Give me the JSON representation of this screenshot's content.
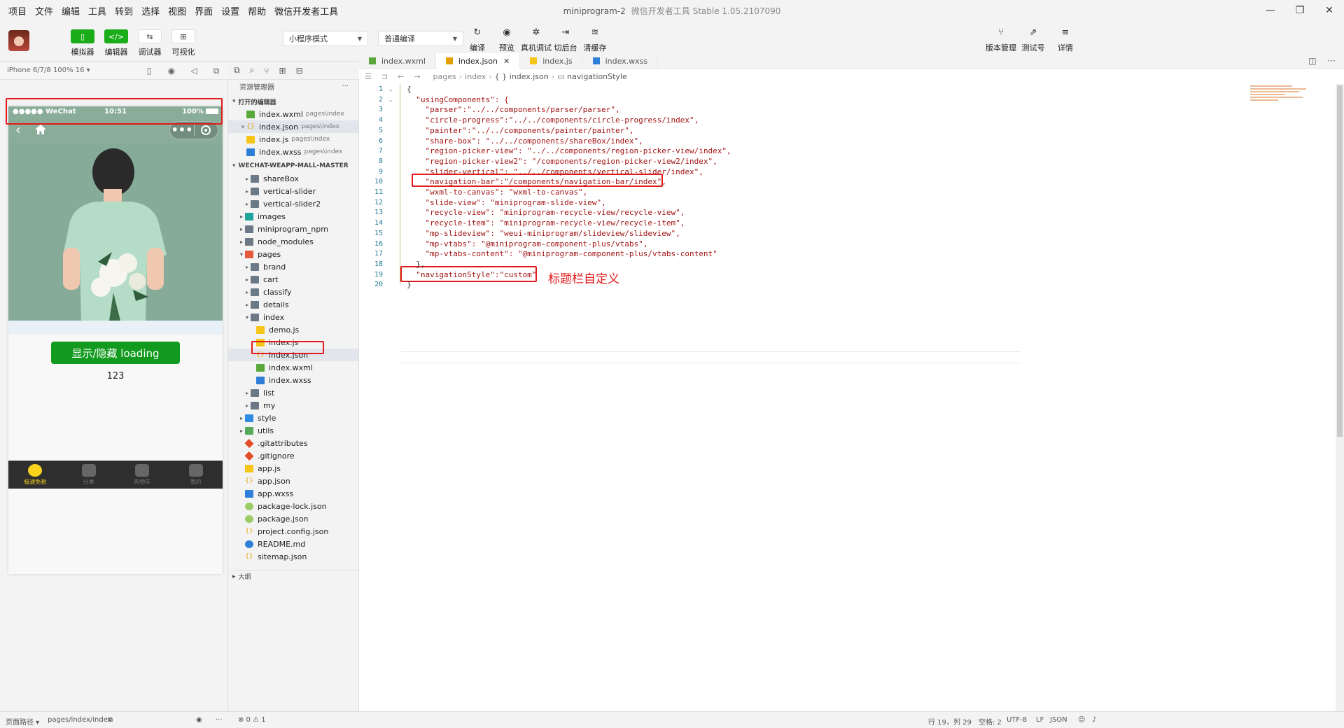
{
  "window": {
    "title": "miniprogram-2",
    "subtitle": "微信开发者工具 Stable 1.05.2107090",
    "controls": [
      "—",
      "❐",
      "✕"
    ]
  },
  "menu": [
    "项目",
    "文件",
    "编辑",
    "工具",
    "转到",
    "选择",
    "视图",
    "界面",
    "设置",
    "帮助",
    "微信开发者工具"
  ],
  "toolbar": {
    "left_buttons": [
      {
        "label": "模拟器",
        "icon": "phone-icon",
        "glyph": "▯",
        "active": true
      },
      {
        "label": "编辑器",
        "icon": "code-icon",
        "glyph": "</>",
        "active": true
      },
      {
        "label": "调试器",
        "icon": "debug-icon",
        "glyph": "⇆",
        "active": false
      },
      {
        "label": "可视化",
        "icon": "layout-icon",
        "glyph": "⊞",
        "active": false
      }
    ],
    "mode_select": "小程序模式",
    "compile_select": "普通编译",
    "middle_buttons": [
      {
        "label": "编译",
        "icon": "refresh-icon",
        "glyph": "↻"
      },
      {
        "label": "预览",
        "icon": "eye-icon",
        "glyph": "◉"
      },
      {
        "label": "真机调试",
        "icon": "bug-icon",
        "glyph": "✲"
      },
      {
        "label": "切后台",
        "icon": "switch-icon",
        "glyph": "⇥"
      },
      {
        "label": "清缓存",
        "icon": "layers-icon",
        "glyph": "≋"
      }
    ],
    "right_buttons": [
      {
        "label": "版本管理",
        "icon": "branch-icon",
        "glyph": "⑂"
      },
      {
        "label": "测试号",
        "icon": "external-icon",
        "glyph": "⇗"
      },
      {
        "label": "详情",
        "icon": "menu-icon",
        "glyph": "≡"
      }
    ]
  },
  "simulator": {
    "device": "iPhone 6/7/8 100% 16 ▾",
    "icons": [
      "▯",
      "◉",
      "◁",
      "⧉"
    ],
    "status_signal": "●●●●● WeChat",
    "status_time": "10:51",
    "status_battery": "100%",
    "button_label": "显示/隐藏 loading",
    "count": "123",
    "tabbar": [
      {
        "label": "极速免税",
        "active": true
      },
      {
        "label": "分类",
        "active": false
      },
      {
        "label": "购物车",
        "active": false
      },
      {
        "label": "我的",
        "active": false
      }
    ]
  },
  "explorer": {
    "icons": [
      "⧉",
      "⌕",
      "⑂",
      "⊞",
      "⊟"
    ],
    "title": "资源管理器",
    "more": "···",
    "open_editors_label": "打开的编辑器",
    "open_editors": [
      {
        "name": "index.wxml",
        "path": "pages\\index",
        "type": "wxml",
        "selected": false,
        "close": ""
      },
      {
        "name": "index.json",
        "path": "pages\\index",
        "type": "json",
        "selected": true,
        "close": "✕"
      },
      {
        "name": "index.js",
        "path": "pages\\index",
        "type": "js",
        "selected": false,
        "close": ""
      },
      {
        "name": "index.wxss",
        "path": "pages\\index",
        "type": "wxss",
        "selected": false,
        "close": ""
      }
    ],
    "project_label": "WECHAT-WEAPP-MALL-MASTER",
    "tree": [
      {
        "name": "shareBox",
        "type": "folder",
        "depth": 2,
        "caret": "▸"
      },
      {
        "name": "vertical-slider",
        "type": "folder",
        "depth": 2,
        "caret": "▸"
      },
      {
        "name": "vertical-slider2",
        "type": "folder",
        "depth": 2,
        "caret": "▸"
      },
      {
        "name": "images",
        "type": "img",
        "depth": 1,
        "caret": "▸"
      },
      {
        "name": "miniprogram_npm",
        "type": "folder",
        "depth": 1,
        "caret": "▸"
      },
      {
        "name": "node_modules",
        "type": "folder",
        "depth": 1,
        "caret": "▸"
      },
      {
        "name": "pages",
        "type": "red",
        "depth": 1,
        "caret": "▾"
      },
      {
        "name": "brand",
        "type": "folder",
        "depth": 2,
        "caret": "▸"
      },
      {
        "name": "cart",
        "type": "folder",
        "depth": 2,
        "caret": "▸"
      },
      {
        "name": "classify",
        "type": "folder",
        "depth": 2,
        "caret": "▸"
      },
      {
        "name": "details",
        "type": "folder",
        "depth": 2,
        "caret": "▸"
      },
      {
        "name": "index",
        "type": "folder",
        "depth": 2,
        "caret": "▾"
      },
      {
        "name": "demo.js",
        "type": "js",
        "depth": 3,
        "caret": ""
      },
      {
        "name": "index.js",
        "type": "js",
        "depth": 3,
        "caret": ""
      },
      {
        "name": "index.json",
        "type": "json",
        "depth": 3,
        "caret": "",
        "selected": true
      },
      {
        "name": "index.wxml",
        "type": "wxml",
        "depth": 3,
        "caret": ""
      },
      {
        "name": "index.wxss",
        "type": "wxss",
        "depth": 3,
        "caret": ""
      },
      {
        "name": "list",
        "type": "folder",
        "depth": 2,
        "caret": "▸"
      },
      {
        "name": "my",
        "type": "folder",
        "depth": 2,
        "caret": "▸"
      },
      {
        "name": "style",
        "type": "sty",
        "depth": 1,
        "caret": "▸"
      },
      {
        "name": "utils",
        "type": "utl",
        "depth": 1,
        "caret": "▸"
      },
      {
        "name": ".gitattributes",
        "type": "git",
        "depth": 1,
        "caret": ""
      },
      {
        "name": ".gitignore",
        "type": "git",
        "depth": 1,
        "caret": ""
      },
      {
        "name": "app.js",
        "type": "js",
        "depth": 1,
        "caret": ""
      },
      {
        "name": "app.json",
        "type": "json",
        "depth": 1,
        "caret": ""
      },
      {
        "name": "app.wxss",
        "type": "wxss",
        "depth": 1,
        "caret": ""
      },
      {
        "name": "package-lock.json",
        "type": "pkg",
        "depth": 1,
        "caret": ""
      },
      {
        "name": "package.json",
        "type": "pkg",
        "depth": 1,
        "caret": ""
      },
      {
        "name": "project.config.json",
        "type": "json",
        "depth": 1,
        "caret": ""
      },
      {
        "name": "README.md",
        "type": "info",
        "depth": 1,
        "caret": ""
      },
      {
        "name": "sitemap.json",
        "type": "json",
        "depth": 1,
        "caret": ""
      }
    ],
    "outline_label": "大纲"
  },
  "editor": {
    "tabs": [
      {
        "name": "index.wxml",
        "type": "wxml",
        "active": false,
        "close": ""
      },
      {
        "name": "index.json",
        "type": "json",
        "active": true,
        "close": "✕"
      },
      {
        "name": "index.js",
        "type": "js",
        "active": false,
        "close": ""
      },
      {
        "name": "index.wxss",
        "type": "wxss",
        "active": false,
        "close": ""
      }
    ],
    "tab_actions": [
      "◫",
      "···"
    ],
    "breadcrumb_icons": [
      "☰",
      "⊐",
      "←",
      "→"
    ],
    "breadcrumb": [
      "pages",
      "index",
      "{ } index.json",
      "▭ navigationStyle"
    ],
    "lines": [
      {
        "n": "1",
        "fold": "⌄",
        "text": "{"
      },
      {
        "n": "2",
        "fold": "⌄",
        "text": "  \"usingComponents\": {"
      },
      {
        "n": "3",
        "fold": "",
        "text": "    \"parser\":\"../../components/parser/parser\","
      },
      {
        "n": "4",
        "fold": "",
        "text": "    \"circle-progress\":\"../../components/circle-progress/index\","
      },
      {
        "n": "5",
        "fold": "",
        "text": "    \"painter\":\"../../components/painter/painter\","
      },
      {
        "n": "6",
        "fold": "",
        "text": "    \"share-box\": \"../../components/shareBox/index\","
      },
      {
        "n": "7",
        "fold": "",
        "text": "    \"region-picker-view\": \"../../components/region-picker-view/index\","
      },
      {
        "n": "8",
        "fold": "",
        "text": "    \"region-picker-view2\": \"/components/region-picker-view2/index\","
      },
      {
        "n": "9",
        "fold": "",
        "text": "    \"slider-vertical\": \"../../components/vertical-slider/index\","
      },
      {
        "n": "10",
        "fold": "",
        "text": "    \"navigation-bar\":\"/components/navigation-bar/index\","
      },
      {
        "n": "11",
        "fold": "",
        "text": "    \"wxml-to-canvas\": \"wxml-to-canvas\","
      },
      {
        "n": "12",
        "fold": "",
        "text": "    \"slide-view\": \"miniprogram-slide-view\","
      },
      {
        "n": "13",
        "fold": "",
        "text": "    \"recycle-view\": \"miniprogram-recycle-view/recycle-view\","
      },
      {
        "n": "14",
        "fold": "",
        "text": "    \"recycle-item\": \"miniprogram-recycle-view/recycle-item\","
      },
      {
        "n": "15",
        "fold": "",
        "text": "    \"mp-slideview\": \"weui-miniprogram/slideview/slideview\","
      },
      {
        "n": "16",
        "fold": "",
        "text": "    \"mp-vtabs\": \"@miniprogram-component-plus/vtabs\","
      },
      {
        "n": "17",
        "fold": "",
        "text": "    \"mp-vtabs-content\": \"@miniprogram-component-plus/vtabs-content\""
      },
      {
        "n": "18",
        "fold": "",
        "text": "  },"
      },
      {
        "n": "19",
        "fold": "",
        "text": "  \"navigationStyle\":\"custom\""
      },
      {
        "n": "20",
        "fold": "",
        "text": "}"
      }
    ],
    "annotation": "标题栏自定义"
  },
  "statusbar": {
    "page_path_label": "页面路径 ▾",
    "page_path": "pages/index/index",
    "problems": "⊗ 0 ⚠ 1",
    "cursor": "行 19，列 29",
    "spaces": "空格: 2",
    "encoding": "UTF-8",
    "eol": "LF",
    "language": "JSON"
  },
  "colors": {
    "accent_green": "#1aad19",
    "phone_nav": "#8aad99",
    "highlight_red": "#e01c1c",
    "json_string": "#a31515",
    "line_number": "#237893"
  }
}
